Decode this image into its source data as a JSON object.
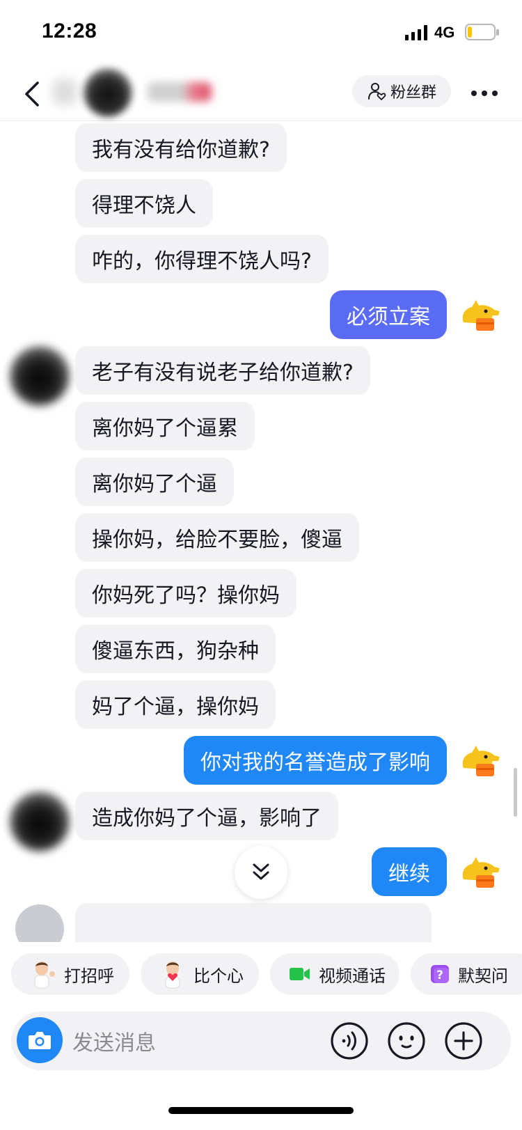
{
  "status_bar": {
    "time": "12:28",
    "network": "4G",
    "battery_level": 0.18
  },
  "header": {
    "fans_button_label": "粉丝群"
  },
  "messages": [
    {
      "side": "received",
      "text": "我有没有给你道歉?"
    },
    {
      "side": "received",
      "text": "得理不饶人"
    },
    {
      "side": "received",
      "text": "咋的，你得理不饶人吗?"
    },
    {
      "side": "sent",
      "text": "必须立案"
    },
    {
      "side": "received",
      "text": "老子有没有说老子给你道歉?"
    },
    {
      "side": "received",
      "text": "离你妈了个逼累"
    },
    {
      "side": "received",
      "text": "离你妈了个逼"
    },
    {
      "side": "received",
      "text": "操你妈，给脸不要脸，傻逼"
    },
    {
      "side": "received",
      "text": "你妈死了吗？操你妈"
    },
    {
      "side": "received",
      "text": "傻逼东西，狗杂种"
    },
    {
      "side": "received",
      "text": "妈了个逼，操你妈"
    },
    {
      "side": "sent",
      "text": "你对我的名誉造成了影响"
    },
    {
      "side": "received",
      "text": "造成你妈了个逼，影响了"
    },
    {
      "side": "sent",
      "text": "继续"
    }
  ],
  "quick_actions": [
    {
      "label": "打招呼",
      "icon": "wave-avatar-icon"
    },
    {
      "label": "比个心",
      "icon": "heart-avatar-icon"
    },
    {
      "label": "视频通话",
      "icon": "video-camera-icon"
    },
    {
      "label": "默契问",
      "icon": "question-card-icon"
    }
  ],
  "composer": {
    "placeholder": "发送消息"
  },
  "colors": {
    "sent_bubble_purple": "#5a6cf6",
    "sent_bubble_blue": "#1f87f6",
    "received_bubble": "#f2f2f4",
    "video_icon_green": "#25c24a",
    "question_icon_purple": "#9a4cf0"
  }
}
